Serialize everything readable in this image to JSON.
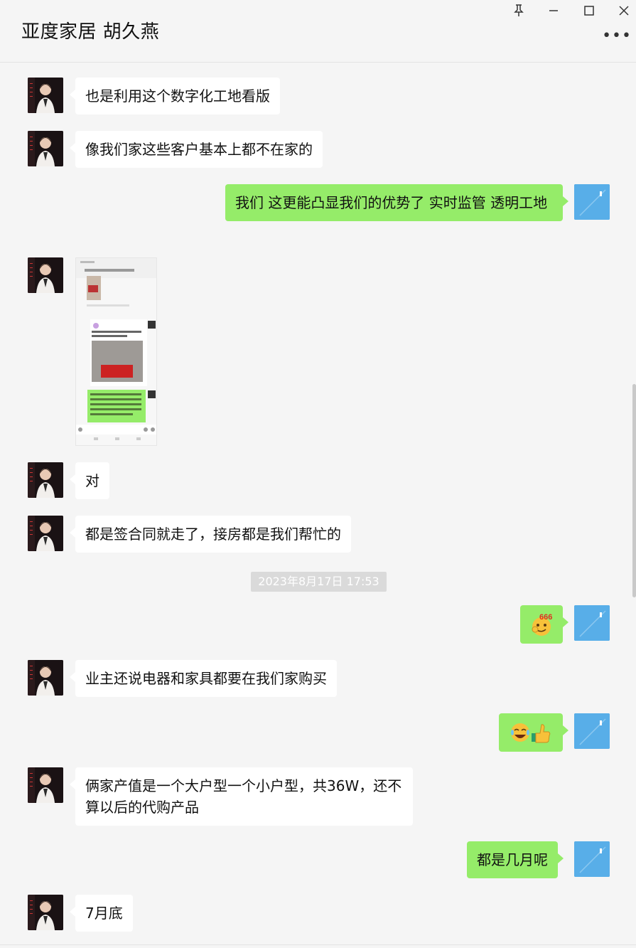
{
  "window": {
    "title": "亚度家居 胡久燕",
    "more_label": "•••"
  },
  "messages": [
    {
      "side": "in",
      "text": "也是利用这个数字化工地看版"
    },
    {
      "side": "in",
      "text": "像我们家这些客户基本上都不在家的"
    },
    {
      "side": "out",
      "text": "我们 这更能凸显我们的优势了  实时监管 透明工地"
    },
    {
      "side": "in",
      "type": "image"
    },
    {
      "side": "in",
      "text": "对"
    },
    {
      "side": "in",
      "text": "都是签合同就走了，接房都是我们帮忙的"
    },
    {
      "type": "time",
      "text": "2023年8月17日 17:53"
    },
    {
      "side": "out",
      "type": "emoji",
      "text": "🤓"
    },
    {
      "side": "in",
      "text": "业主还说电器和家具都要在我们家购买"
    },
    {
      "side": "out",
      "type": "emoji",
      "text": "😂👍"
    },
    {
      "side": "in",
      "text": "俩家产值是一个大户型一个小户型，共36W，还不算以后的代购产品"
    },
    {
      "side": "out",
      "text": "都是几月呢"
    },
    {
      "side": "in",
      "text": "7月底"
    }
  ],
  "colors": {
    "background": "#f5f5f5",
    "incoming_bubble": "#ffffff",
    "outgoing_bubble": "#95ec69",
    "timestamp_bg": "#dadada",
    "self_avatar": "#58aee8"
  },
  "icons": [
    "pin-icon",
    "minimize-icon",
    "maximize-icon",
    "close-icon",
    "more-icon"
  ]
}
